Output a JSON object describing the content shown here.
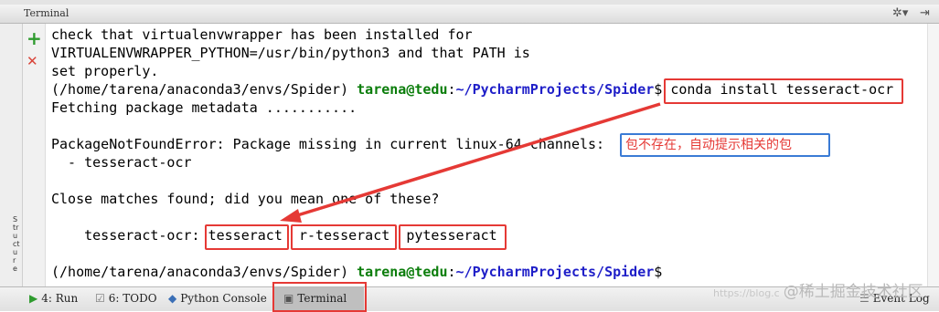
{
  "panel": {
    "title": "Terminal",
    "settings_glyph": "✲▾",
    "hide_glyph": "⇥"
  },
  "gutter": {
    "add_glyph": "+",
    "close_glyph": "✕"
  },
  "sidebar_vertical_label": "Structure",
  "terminal": {
    "lines": [
      "check that virtualenvwrapper has been installed for",
      "VIRTUALENVWRAPPER_PYTHON=/usr/bin/python3 and that PATH is",
      "set properly."
    ],
    "prompt1": {
      "env": "(/home/tarena/anaconda3/envs/Spider) ",
      "user": "tarena@tedu",
      "sep": ":",
      "path": "~/PycharmProjects/Spider",
      "sym": "$ ",
      "cmd": "conda install tesseract-ocr"
    },
    "fetching": "Fetching package metadata ...........",
    "error_line": "PackageNotFoundError: Package missing in current linux-64 channels: ",
    "missing_item": "  - tesseract-ocr",
    "close_matches": "Close matches found; did you mean one of these?",
    "suggest_label": "    tesseract-ocr: ",
    "suggestions": [
      "tesseract",
      "r-tesseract",
      "pytesseract"
    ],
    "prompt2": {
      "env": "(/home/tarena/anaconda3/envs/Spider) ",
      "user": "tarena@tedu",
      "sep": ":",
      "path": "~/PycharmProjects/Spider",
      "sym": "$"
    }
  },
  "annotation": {
    "note": "包不存在，自动提示相关的包",
    "box_color": "#e53935",
    "note_border": "#3a7bd5"
  },
  "statusbar": {
    "run": {
      "label": "4: Run",
      "icon": "run-icon"
    },
    "todo": {
      "label": "6: TODO",
      "icon": "todo-icon"
    },
    "console": {
      "label": "Python Console",
      "icon": "python-console-icon"
    },
    "terminal": {
      "label": "Terminal",
      "icon": "terminal-icon"
    },
    "eventlog": {
      "label": "Event Log",
      "icon": "event-log-icon"
    }
  },
  "watermark": {
    "small": "https://blog.c",
    "main": "@稀土掘金技术社区"
  }
}
